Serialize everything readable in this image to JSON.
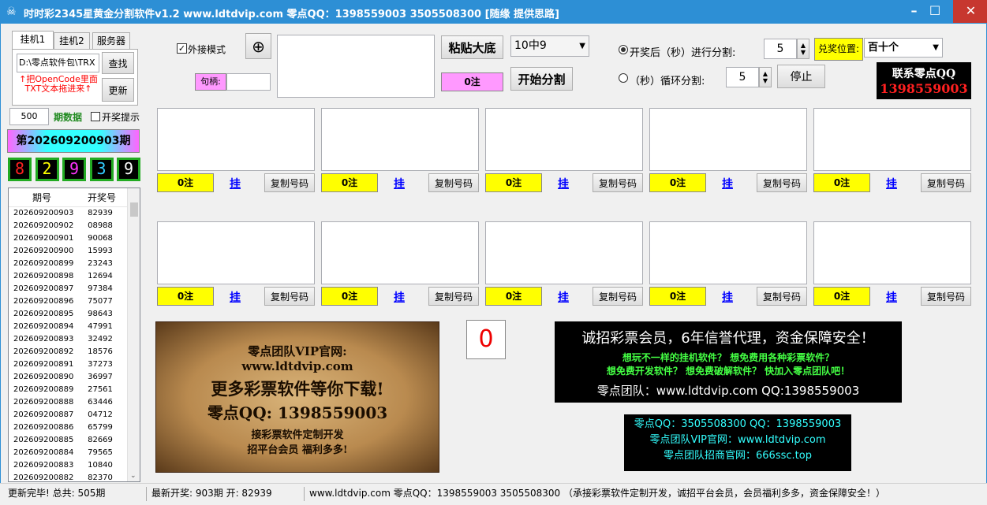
{
  "window": {
    "title": "时时彩2345星黄金分割软件v1.2    www.ldtdvip.com    零点QQ：1398559003   3505508300 [随缘 提供思路]"
  },
  "tabs": [
    "挂机1",
    "挂机2",
    "服务器"
  ],
  "path_input": "D:\\零点软件包\\TRX",
  "buttons": {
    "find": "查找",
    "update": "更新",
    "paste": "粘贴大底",
    "start": "开始分割",
    "stop": "停止"
  },
  "hint": "↑把OpenCode里面\nTXT文本拖进来↑",
  "external_mode": "外接模式",
  "handle_label": "句柄:",
  "combo_main": "10中9",
  "count_main": "0注",
  "after_draw_label": "开奖后（秒）进行分割:",
  "after_draw_value": "5",
  "loop_label": "（秒）循环分割:",
  "loop_value": "5",
  "prize_pos_label": "兑奖位置:",
  "prize_pos_value": "百十个",
  "contact": {
    "title": "联系零点QQ",
    "qq": "1398559003"
  },
  "period_count": "500",
  "period_data_label": "期数据",
  "draw_notice": "开奖提示",
  "current_period": "第202609200903期",
  "current_digits": [
    "8",
    "2",
    "9",
    "3",
    "9"
  ],
  "digit_colors": [
    "#ff2020",
    "#ffff00",
    "#ff33ff",
    "#33ccff",
    "#ffffff"
  ],
  "slots": [
    {
      "count": "0注",
      "hang": "挂",
      "copy": "复制号码"
    },
    {
      "count": "0注",
      "hang": "挂",
      "copy": "复制号码"
    },
    {
      "count": "0注",
      "hang": "挂",
      "copy": "复制号码"
    },
    {
      "count": "0注",
      "hang": "挂",
      "copy": "复制号码"
    },
    {
      "count": "0注",
      "hang": "挂",
      "copy": "复制号码"
    },
    {
      "count": "0注",
      "hang": "挂",
      "copy": "复制号码"
    },
    {
      "count": "0注",
      "hang": "挂",
      "copy": "复制号码"
    },
    {
      "count": "0注",
      "hang": "挂",
      "copy": "复制号码"
    },
    {
      "count": "0注",
      "hang": "挂",
      "copy": "复制号码"
    },
    {
      "count": "0注",
      "hang": "挂",
      "copy": "复制号码"
    }
  ],
  "history": {
    "headers": [
      "期号",
      "开奖号"
    ],
    "rows": [
      [
        "202609200903",
        "82939"
      ],
      [
        "202609200902",
        "08988"
      ],
      [
        "202609200901",
        "90068"
      ],
      [
        "202609200900",
        "15993"
      ],
      [
        "202609200899",
        "23243"
      ],
      [
        "202609200898",
        "12694"
      ],
      [
        "202609200897",
        "97384"
      ],
      [
        "202609200896",
        "75077"
      ],
      [
        "202609200895",
        "98643"
      ],
      [
        "202609200894",
        "47991"
      ],
      [
        "202609200893",
        "32492"
      ],
      [
        "202609200892",
        "18576"
      ],
      [
        "202609200891",
        "37273"
      ],
      [
        "202609200890",
        "36997"
      ],
      [
        "202609200889",
        "27561"
      ],
      [
        "202609200888",
        "63446"
      ],
      [
        "202609200887",
        "04712"
      ],
      [
        "202609200886",
        "65799"
      ],
      [
        "202609200885",
        "82669"
      ],
      [
        "202609200884",
        "79565"
      ],
      [
        "202609200883",
        "10840"
      ],
      [
        "202609200882",
        "82370"
      ]
    ]
  },
  "ad_scroll": {
    "line1": "零点团队VIP官网:",
    "line2": "www.ldtdvip.com",
    "line3": "更多彩票软件等你下载!",
    "line4": "零点QQ: 1398559003",
    "line5": "接彩票软件定制开发",
    "line6": "招平台会员  福利多多!"
  },
  "counter": "0",
  "ad_right": {
    "title": "诚招彩票会员，6年信誉代理，资金保障安全！",
    "line2": "想玩不一样的挂机软件？ 想免费用各种彩票软件？",
    "line3": "想免费开发软件？ 想免费破解软件？ 快加入零点团队吧！",
    "line4": "零点团队：www.ldtdvip.com   QQ:1398559003"
  },
  "ad_small": {
    "line1": "零点QQ：3505508300  QQ：1398559003",
    "line2": "零点团队VIP官网：www.ldtdvip.com",
    "line3": "零点团队招商官网：666ssc.top"
  },
  "status": {
    "left": "更新完毕! 总共: 505期",
    "mid": "最新开奖: 903期 开: 82939",
    "right": "www.ldtdvip.com   零点QQ：1398559003  3505508300  （承接彩票软件定制开发，诚招平台会员，会员福利多多，资金保障安全！）"
  }
}
